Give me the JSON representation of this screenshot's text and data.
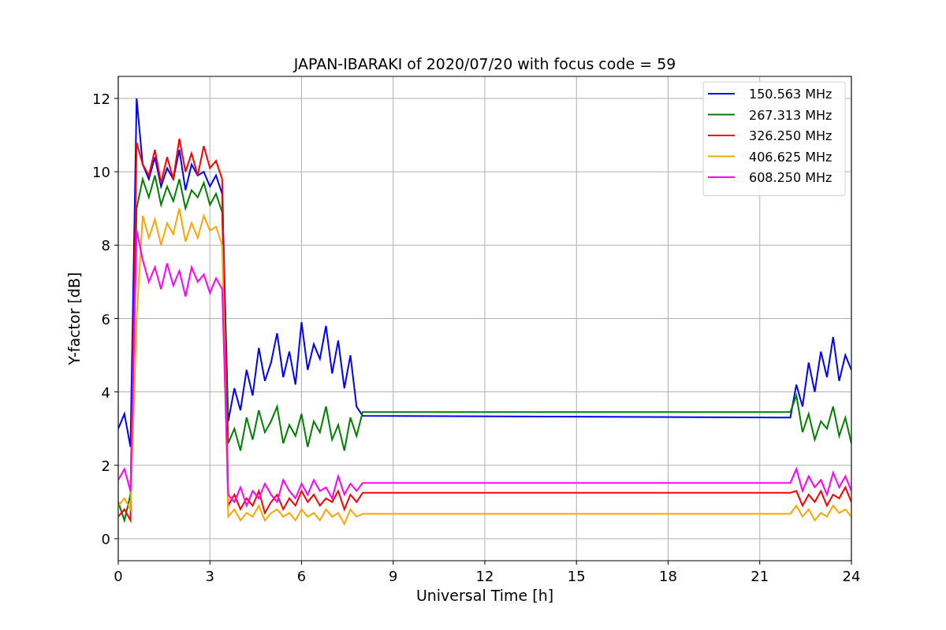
{
  "chart_data": {
    "type": "line",
    "title": "JAPAN-IBARAKI of 2020/07/20 with focus code = 59",
    "xlabel": "Universal Time [h]",
    "ylabel": "Y-factor [dB]",
    "x": [
      0,
      0.2,
      0.4,
      0.6,
      0.8,
      1.0,
      1.2,
      1.4,
      1.6,
      1.8,
      2.0,
      2.2,
      2.4,
      2.6,
      2.8,
      3.0,
      3.2,
      3.4,
      3.6,
      3.8,
      4.0,
      4.2,
      4.4,
      4.6,
      4.8,
      5.0,
      5.2,
      5.4,
      5.6,
      5.8,
      6.0,
      6.2,
      6.4,
      6.6,
      6.8,
      7.0,
      7.2,
      7.4,
      7.6,
      7.8,
      8.0,
      22.0,
      22.2,
      22.4,
      22.6,
      22.8,
      23.0,
      23.2,
      23.4,
      23.6,
      23.8,
      24.0
    ],
    "series": [
      {
        "name": "150.563 MHz",
        "color": "#0000ff",
        "values": [
          3.0,
          3.4,
          2.5,
          12.0,
          10.2,
          9.8,
          10.4,
          9.6,
          10.1,
          9.8,
          10.6,
          9.5,
          10.2,
          9.9,
          10.0,
          9.6,
          9.9,
          9.4,
          3.2,
          4.1,
          3.5,
          4.6,
          3.9,
          5.2,
          4.3,
          4.8,
          5.6,
          4.4,
          5.1,
          4.2,
          5.9,
          4.6,
          5.3,
          4.9,
          5.8,
          4.5,
          5.4,
          4.1,
          5.0,
          3.6,
          3.35,
          3.3,
          4.2,
          3.6,
          4.8,
          4.0,
          5.1,
          4.4,
          5.5,
          4.3,
          5.0,
          4.6
        ]
      },
      {
        "name": "267.313 MHz",
        "color": "#008000",
        "values": [
          1.0,
          0.5,
          1.2,
          9.0,
          9.8,
          9.3,
          9.9,
          9.1,
          9.6,
          9.2,
          9.8,
          9.0,
          9.5,
          9.3,
          9.7,
          9.1,
          9.4,
          8.9,
          2.6,
          3.0,
          2.4,
          3.3,
          2.7,
          3.5,
          2.9,
          3.2,
          3.6,
          2.6,
          3.1,
          2.8,
          3.4,
          2.5,
          3.2,
          2.9,
          3.6,
          2.7,
          3.1,
          2.4,
          3.3,
          2.8,
          3.45,
          3.45,
          3.9,
          2.9,
          3.4,
          2.7,
          3.2,
          3.0,
          3.6,
          2.8,
          3.3,
          2.6
        ]
      },
      {
        "name": "326.250 MHz",
        "color": "#ff0000",
        "values": [
          0.6,
          0.8,
          0.5,
          10.8,
          10.2,
          9.9,
          10.6,
          9.7,
          10.4,
          9.8,
          10.9,
          10.0,
          10.5,
          9.9,
          10.7,
          10.1,
          10.3,
          9.8,
          0.9,
          1.2,
          0.8,
          1.1,
          0.9,
          1.3,
          0.7,
          1.0,
          1.2,
          0.8,
          1.1,
          0.9,
          1.3,
          1.0,
          1.2,
          0.9,
          1.1,
          1.0,
          1.3,
          0.8,
          1.2,
          1.0,
          1.25,
          1.25,
          1.3,
          0.9,
          1.2,
          1.0,
          1.3,
          0.9,
          1.2,
          1.1,
          1.4,
          1.0
        ]
      },
      {
        "name": "406.625 MHz",
        "color": "#ffa500",
        "values": [
          0.9,
          1.1,
          0.8,
          6.0,
          8.8,
          8.2,
          8.7,
          8.0,
          8.6,
          8.3,
          9.0,
          8.1,
          8.6,
          8.2,
          8.8,
          8.4,
          8.5,
          8.0,
          0.6,
          0.8,
          0.5,
          0.7,
          0.6,
          0.9,
          0.5,
          0.7,
          0.8,
          0.6,
          0.7,
          0.5,
          0.8,
          0.6,
          0.7,
          0.5,
          0.8,
          0.6,
          0.7,
          0.4,
          0.8,
          0.6,
          0.68,
          0.68,
          0.9,
          0.6,
          0.8,
          0.5,
          0.7,
          0.6,
          0.9,
          0.7,
          0.8,
          0.6
        ]
      },
      {
        "name": "608.250 MHz",
        "color": "#ff00ff",
        "values": [
          1.6,
          1.9,
          1.3,
          8.4,
          7.6,
          7.0,
          7.4,
          6.8,
          7.5,
          6.9,
          7.3,
          6.6,
          7.4,
          7.0,
          7.2,
          6.7,
          7.1,
          6.8,
          1.2,
          1.0,
          1.4,
          0.9,
          1.3,
          1.1,
          1.5,
          1.2,
          1.0,
          1.6,
          1.3,
          1.1,
          1.5,
          1.2,
          1.6,
          1.3,
          1.4,
          1.1,
          1.7,
          1.2,
          1.5,
          1.3,
          1.52,
          1.52,
          1.9,
          1.3,
          1.7,
          1.4,
          1.6,
          1.2,
          1.8,
          1.4,
          1.7,
          1.3
        ]
      }
    ],
    "grid": true,
    "legend": true,
    "xlim": [
      0,
      24
    ],
    "ylim": [
      -0.6,
      12.6
    ],
    "xticks": [
      0,
      3,
      6,
      9,
      12,
      15,
      18,
      21,
      24
    ],
    "yticks": [
      0,
      2,
      4,
      6,
      8,
      10,
      12
    ]
  }
}
